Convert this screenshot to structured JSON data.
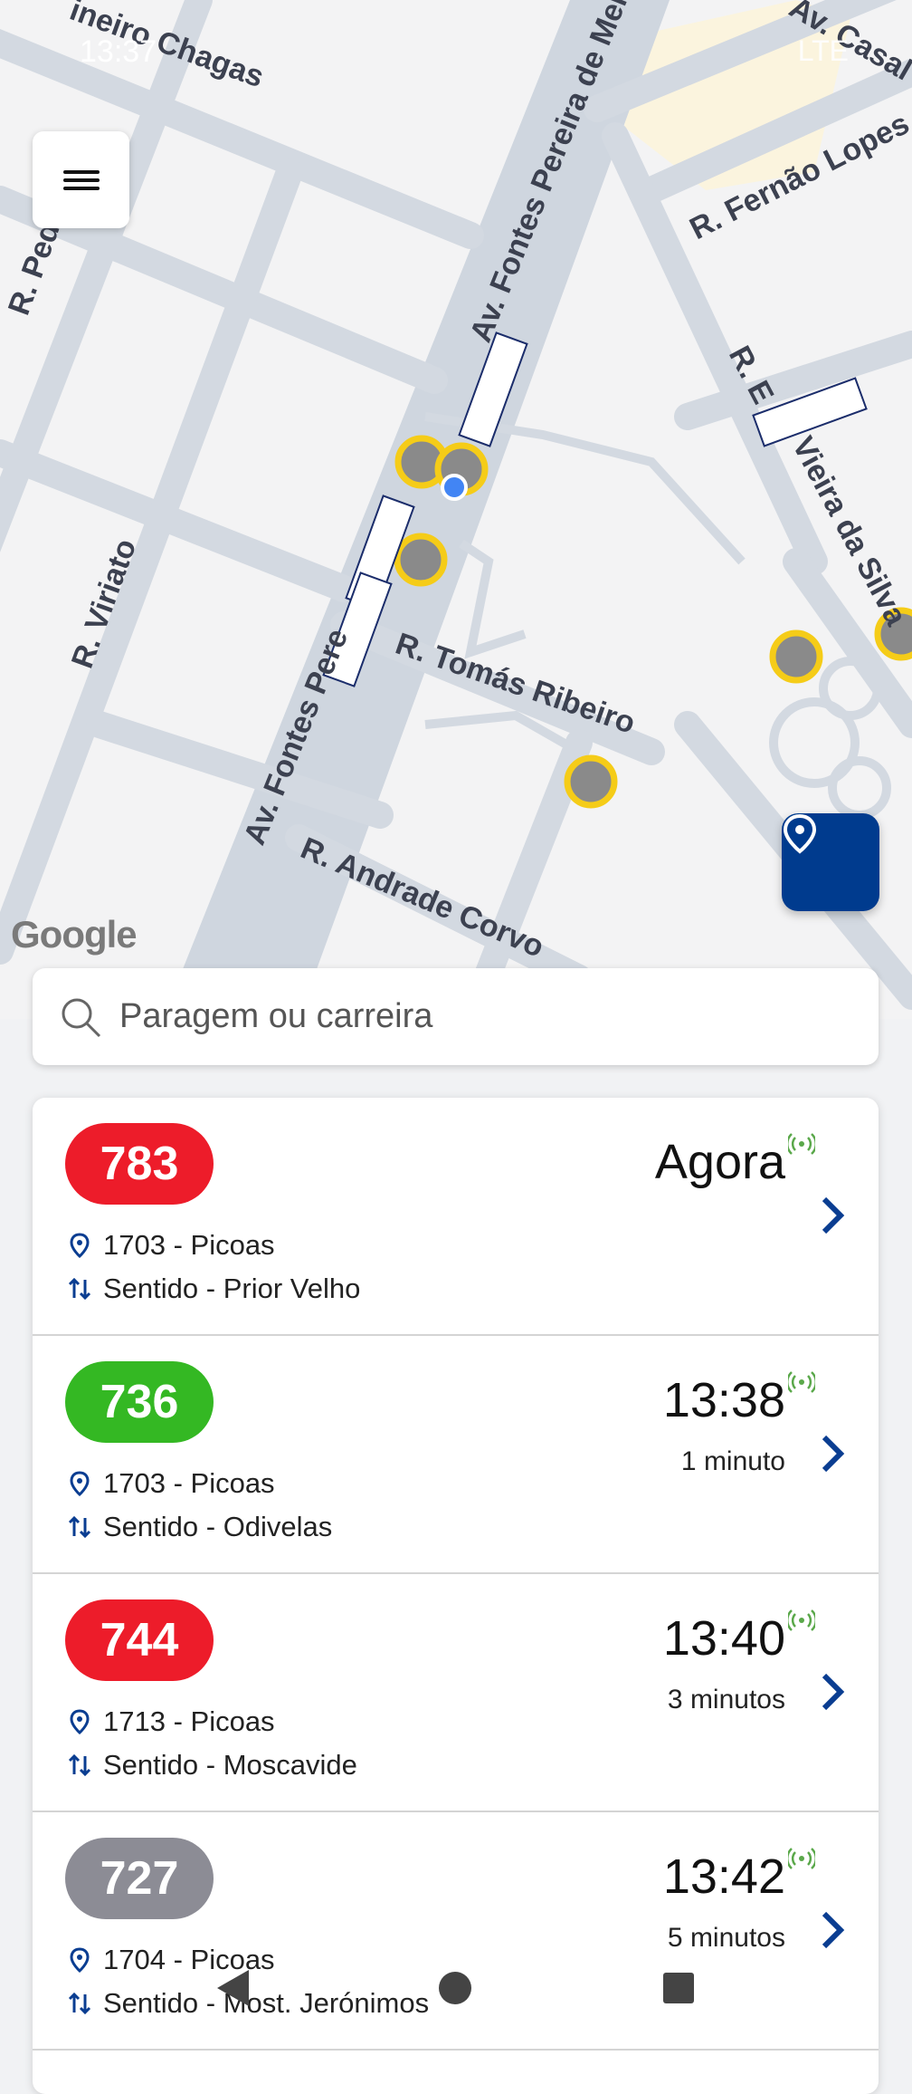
{
  "status_bar": {
    "time": "13:37",
    "icons": "LTE"
  },
  "map": {
    "google_logo": "Google",
    "streets": [
      "Av. Fontes Pereira de Melo",
      "R. Fernão Lopes",
      "Av. Casal R",
      "R. Tomás Ribeiro",
      "R. Viriato",
      "Av. Fontes Pere",
      "R. Andrade Corvo",
      "R. E",
      "Vieira da Silva",
      "R. Pedr",
      "ineiro Chagas"
    ]
  },
  "search": {
    "placeholder": "Paragem ou carreira"
  },
  "arrivals": [
    {
      "line": "783",
      "color": "#ed1c2a",
      "stop": "1703 - Picoas",
      "direction": "Sentido - Prior Velho",
      "time": "Agora",
      "minutes": ""
    },
    {
      "line": "736",
      "color": "#34b823",
      "stop": "1703 - Picoas",
      "direction": "Sentido - Odivelas",
      "time": "13:38",
      "minutes": "1 minuto"
    },
    {
      "line": "744",
      "color": "#ed1c2a",
      "stop": "1713 - Picoas",
      "direction": "Sentido - Moscavide",
      "time": "13:40",
      "minutes": "3 minutos"
    },
    {
      "line": "727",
      "color": "#8c8c95",
      "stop": "1704 - Picoas",
      "direction": "Sentido - Most. Jerónimos",
      "time": "13:42",
      "minutes": "5 minutos"
    }
  ],
  "colors": {
    "accent": "#003b8e",
    "realtime": "#5aa84a"
  }
}
